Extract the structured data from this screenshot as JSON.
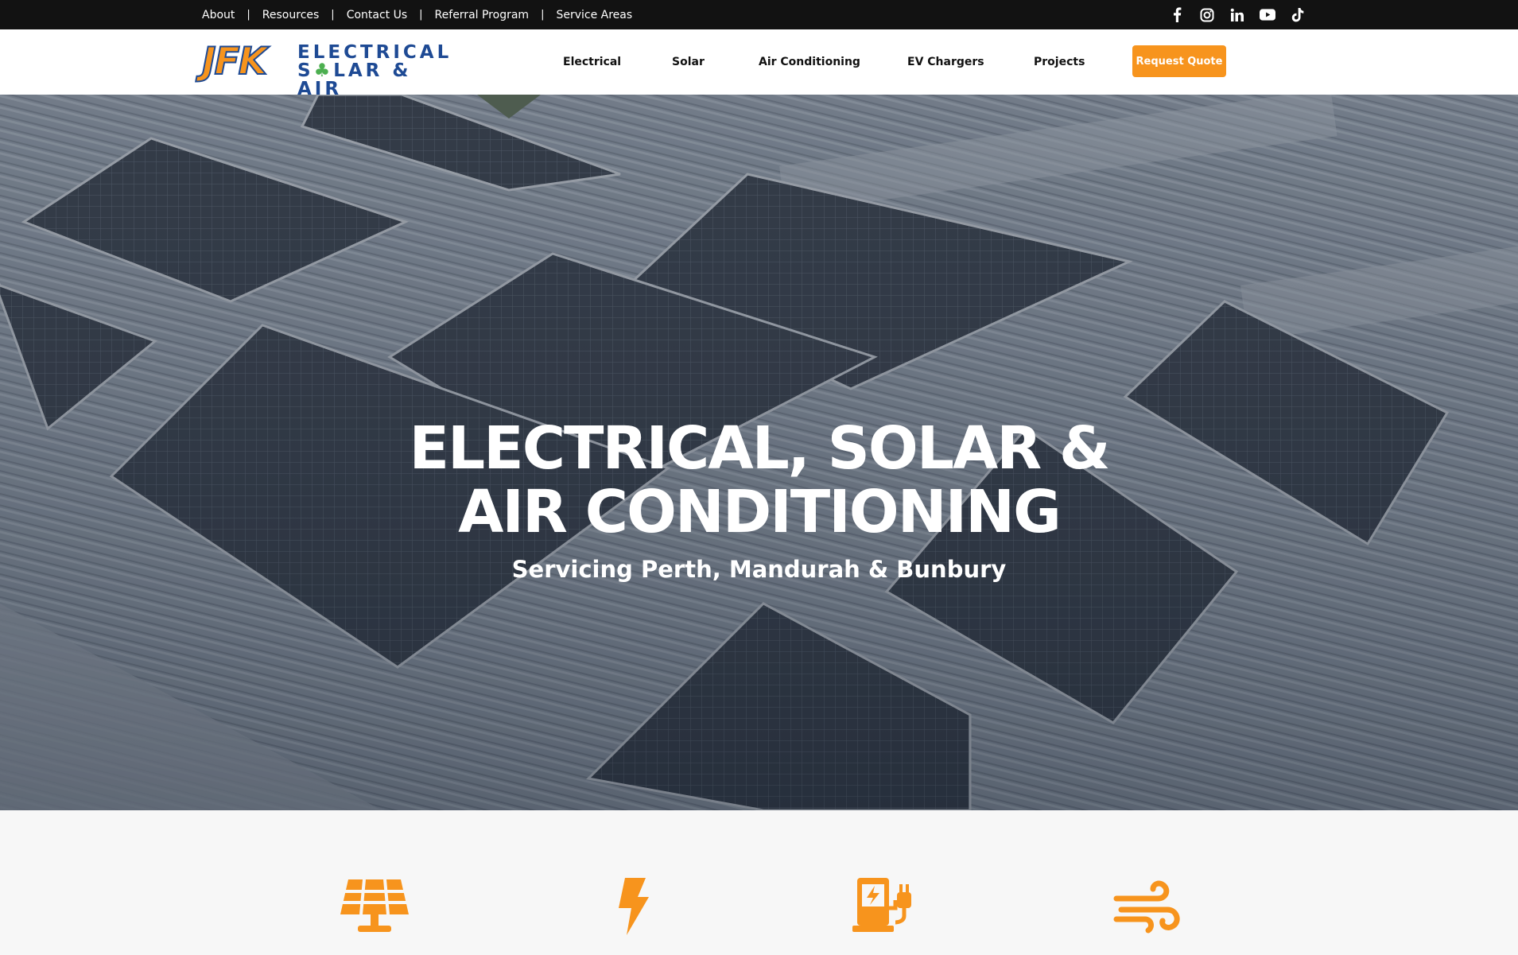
{
  "topbar": {
    "links": [
      {
        "label": "About"
      },
      {
        "label": "Resources"
      },
      {
        "label": "Contact Us"
      },
      {
        "label": "Referral Program"
      },
      {
        "label": "Service Areas"
      }
    ],
    "separator": "|",
    "social": [
      "facebook-icon",
      "instagram-icon",
      "linkedin-icon",
      "youtube-icon",
      "tiktok-icon"
    ]
  },
  "header": {
    "logo": {
      "mark": "JFK",
      "line1": "ELECTRICAL",
      "line2_a": "S",
      "line2_b": "LAR & AIR"
    },
    "nav": [
      {
        "label": "Electrical"
      },
      {
        "label": "Solar"
      },
      {
        "label": "Air Conditioning"
      },
      {
        "label": "EV Chargers"
      },
      {
        "label": "Projects"
      }
    ],
    "cta": "Request Quote"
  },
  "hero": {
    "title_line1": "ELECTRICAL, SOLAR &",
    "title_line2": "AIR CONDITIONING",
    "subtitle": "Servicing Perth, Mandurah & Bunbury"
  },
  "services": {
    "icons": [
      "solar-panel-icon",
      "lightning-bolt-icon",
      "ev-charger-icon",
      "wind-icon"
    ]
  },
  "colors": {
    "accent": "#f7941d",
    "brand_blue": "#1e4a94",
    "brand_green": "#4caf50",
    "topbar": "#121212"
  }
}
